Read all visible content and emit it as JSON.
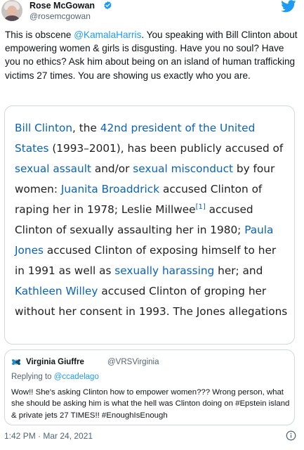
{
  "author": {
    "display_name": "Rose McGowan",
    "handle": "@rosemcgowan"
  },
  "tweet": {
    "text_before_mention": "This is obscene ",
    "mention": "@KamalaHarris",
    "text_after_mention": ". You speaking with Bill Clinton about empowering women & girls is disgusting. Have you no soul? Have you no ethics? Ask him about being on an island of human trafficking victims 27 times. You are showing us exactly who you are."
  },
  "wiki_card": {
    "segments": [
      {
        "text": "Bill Clinton",
        "link": true
      },
      {
        "text": ", the ",
        "link": false
      },
      {
        "text": "42nd president of the United States",
        "link": true
      },
      {
        "text": " (1993–2001), has been publicly accused of ",
        "link": false
      },
      {
        "text": "sexual assault",
        "link": true
      },
      {
        "text": " and/or ",
        "link": false
      },
      {
        "text": "sexual misconduct",
        "link": true
      },
      {
        "text": " by four women: ",
        "link": false
      },
      {
        "text": "Juanita Broaddrick",
        "link": true
      },
      {
        "text": " accused Clinton of raping her in 1978; Leslie Millwee",
        "link": false
      },
      {
        "text": "[1]",
        "link": true,
        "sup": true
      },
      {
        "text": " accused Clinton of sexually assaulting her in 1980; ",
        "link": false
      },
      {
        "text": "Paula Jones",
        "link": true
      },
      {
        "text": " accused Clinton of exposing himself to her in 1991 as well as ",
        "link": false
      },
      {
        "text": "sexually harassing",
        "link": true
      },
      {
        "text": " her; and ",
        "link": false
      },
      {
        "text": "Kathleen Willey",
        "link": true
      },
      {
        "text": " accused Clinton of groping her without her consent in 1993. The Jones allegations",
        "link": false
      }
    ]
  },
  "quoted_tweet": {
    "display_name": "Virginia Giuffre",
    "handle": "@VRSVirginia",
    "replying_prefix": "Replying to ",
    "replying_to": "@ccadelago",
    "text": "Wow!! She's asking Clinton how to empower women??? Wrong person, what she should be asking him is what the hell was Clinton doing on #Epstein island & private jets 27 TIMES!! #EnoughIsEnough"
  },
  "timestamp": "1:42 PM · Mar 24, 2021",
  "colors": {
    "twitter_blue": "#1d9bf0",
    "wiki_link": "#0b63b5",
    "secondary_text": "#536471"
  },
  "icons": {
    "verified": "verified-badge-icon",
    "brand": "twitter-bird-icon",
    "info": "info-icon",
    "quote_avatar": "butterfly-icon"
  }
}
